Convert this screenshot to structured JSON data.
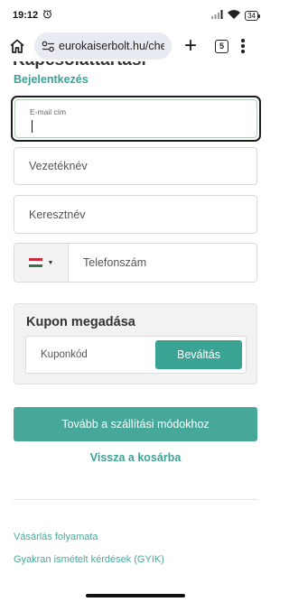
{
  "statusbar": {
    "time": "19:12",
    "battery": "34"
  },
  "browser": {
    "url": "eurokaiserbolt.hu/che",
    "tab_count": "5"
  },
  "page": {
    "cutoff_heading": "Kapcsolattartási adatok",
    "login_link": "Bejelentkezés",
    "email_label": "E-mail cím",
    "lastname_placeholder": "Vezetéknév",
    "firstname_placeholder": "Keresztnév",
    "phone_placeholder": "Telefonszám",
    "coupon": {
      "title": "Kupon megadása",
      "placeholder": "Kuponkód",
      "button": "Beváltás"
    },
    "primary_button": "Tovább a szállítási módokhoz",
    "back_link": "Vissza a kosárba",
    "footer_links": [
      "Vásárlás folyamata",
      "Gyakran ismételt kérdések (GYIK)"
    ]
  },
  "colors": {
    "accent": "#3aa394",
    "flag_red": "#cd2a3e",
    "flag_white": "#ffffff",
    "flag_green": "#436f4d"
  }
}
